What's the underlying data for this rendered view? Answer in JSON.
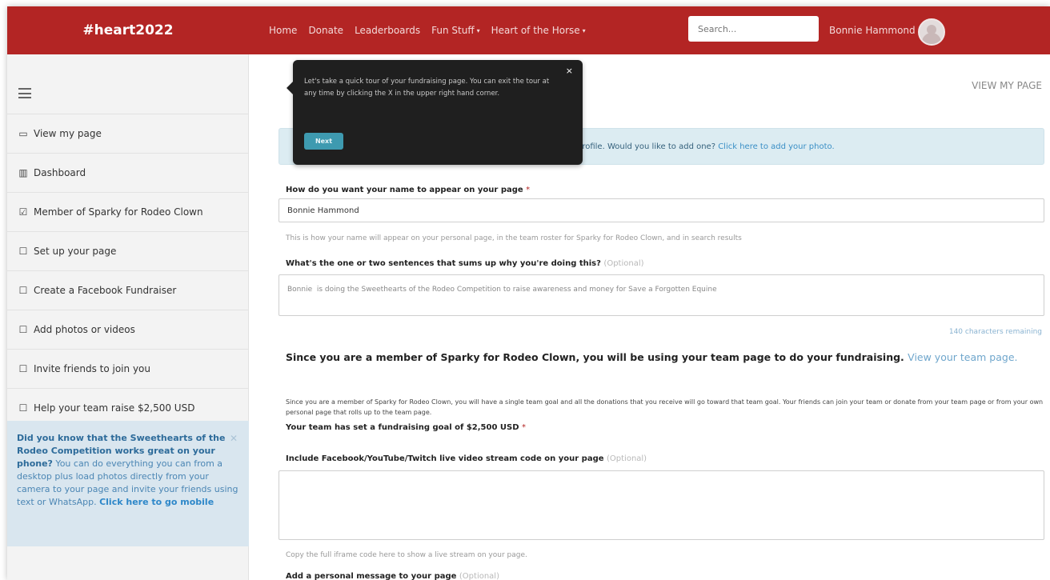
{
  "navbar": {
    "brand": "#heart2022",
    "links": [
      {
        "label": "Home"
      },
      {
        "label": "Donate"
      },
      {
        "label": "Leaderboards"
      },
      {
        "label": "Fun Stuff"
      },
      {
        "label": "Heart of the Horse"
      }
    ],
    "search_placeholder": "Search...",
    "user_name": "Bonnie Hammond",
    "color": "#b32524"
  },
  "sidebar": {
    "items": [
      {
        "icon": "monitor-icon",
        "label": "View my page"
      },
      {
        "icon": "bar-chart-icon",
        "label": "Dashboard"
      },
      {
        "icon": "checked-box-icon",
        "label": "Member of Sparky for Rodeo Clown"
      },
      {
        "icon": "checkbox-icon",
        "label": "Set up your page"
      },
      {
        "icon": "checkbox-icon",
        "label": "Create a Facebook Fundraiser"
      },
      {
        "icon": "checkbox-icon",
        "label": "Add photos or videos"
      },
      {
        "icon": "checkbox-icon",
        "label": "Invite friends to join you"
      },
      {
        "icon": "checkbox-icon",
        "label": "Help your team raise $2,500 USD"
      }
    ],
    "tip": {
      "bold": "Did you know that the Sweethearts of the Rodeo Competition works great on your phone?",
      "text": " You can do everything you can from a desktop plus load photos directly from your camera to your page and invite your friends using text or WhatsApp. ",
      "link": "Click here to go mobile"
    }
  },
  "main": {
    "view_my_page": "VIEW MY PAGE",
    "alert": {
      "text": "profile. Would you like to add one? ",
      "link": "Click here to add your photo."
    },
    "name_label": "How do you want your name to appear on your page",
    "name_value": "Bonnie Hammond",
    "name_help": "This is how your name will appear on your personal page, in the team roster for Sparky for Rodeo Clown, and in search results",
    "sentence_label": "What's the one or two sentences that sums up why you're doing this?",
    "optional": "(Optional)",
    "sentence_value": "Bonnie  is doing the Sweethearts of the Rodeo Competition to raise awareness and money for Save a Forgotten Equine",
    "chars_remaining": "140 characters remaining",
    "team_heading": "Since you are a member of Sparky for Rodeo Clown, you will be using your team page to do your fundraising.",
    "team_link": "View your team page.",
    "team_paragraph": "Since you are a member of Sparky for Rodeo Clown, you will have a single team goal and all the donations that you receive will go toward that team goal. Your friends can join your team or donate from your team page or from your own personal page that rolls up to the team page.",
    "goal_label": "Your team has set a fundraising goal of $2,500 USD",
    "stream_label": "Include Facebook/YouTube/Twitch live video stream code on your page",
    "stream_help": "Copy the full iframe code here to show a live stream on your page.",
    "message_label": "Add a personal message to your page"
  },
  "tour": {
    "text": "Let's take a quick tour of your fundraising page. You can exit the tour at any time by clicking the X in the upper right hand corner.",
    "next_label": "Next",
    "close": "×"
  }
}
